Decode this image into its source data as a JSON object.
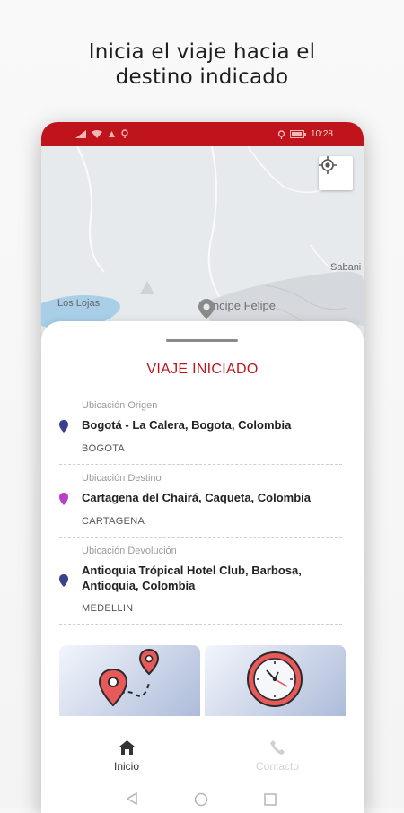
{
  "headline": {
    "line1": "Inicia el viaje hacia el",
    "line2": "destino indicado"
  },
  "status_bar": {
    "time": "10:28",
    "color": "#c0141c"
  },
  "map": {
    "place_name": "Principe Felipe",
    "labels": {
      "los_lojas": "Los Lojas",
      "sabana": "Sabani"
    },
    "locate_icon": "my-location-icon"
  },
  "trip": {
    "title": "VIAJE INICIADO",
    "locations": [
      {
        "label": "Ubicación Origen",
        "address": "Bogotá - La Calera, Bogota, Colombia",
        "city": "BOGOTA",
        "pin_color": "#3b3f8f"
      },
      {
        "label": "Ubicación Destino",
        "address": "Cartagena del Chairá, Caqueta, Colombia",
        "city": "CARTAGENA",
        "pin_color": "#b93fc4"
      },
      {
        "label": "Ubicación Devolución",
        "address_line1": "Antioquia Trópical Hotel Club, Barbosa,",
        "address_line2": "Antioquia, Colombia",
        "city": "MEDELLIN",
        "pin_color": "#3b3f8f"
      }
    ]
  },
  "cards": [
    {
      "icon": "route-pins-icon"
    },
    {
      "icon": "clock-icon"
    }
  ],
  "bottom_nav": {
    "items": [
      {
        "label": "Inicio",
        "icon": "home-icon",
        "active": true
      },
      {
        "label": "Contacto",
        "icon": "phone-icon",
        "active": false
      }
    ]
  },
  "colors": {
    "accent": "#c0141c",
    "text": "#222222",
    "muted": "#9b9b9b"
  }
}
